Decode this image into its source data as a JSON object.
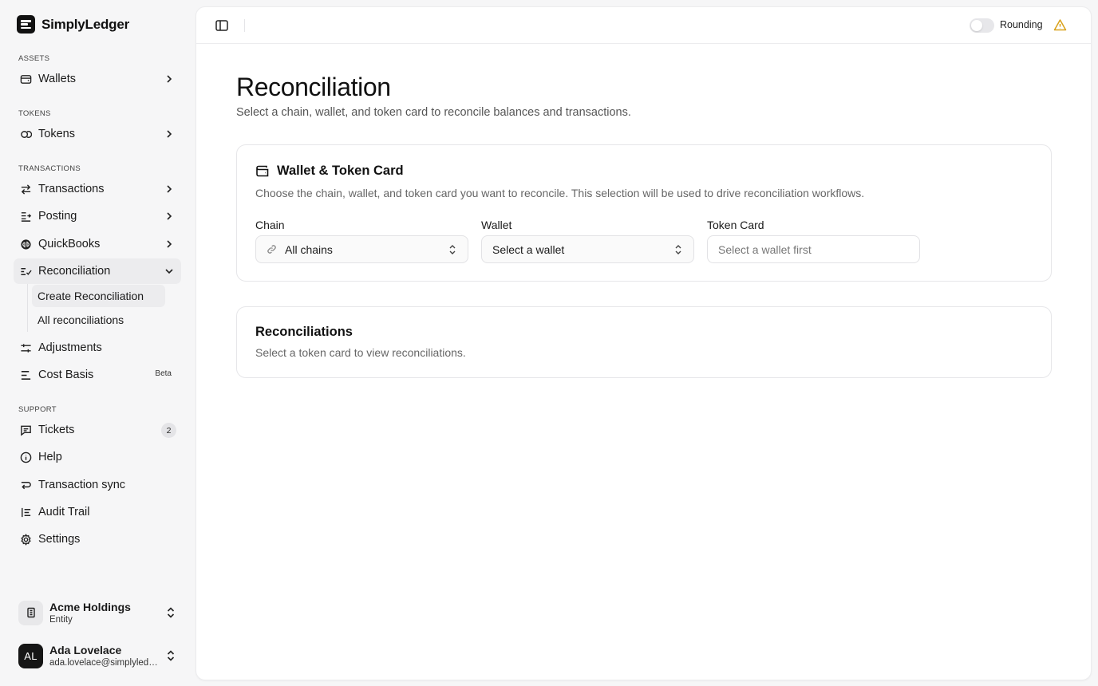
{
  "brand": {
    "name": "SimplyLedger"
  },
  "sidebar": {
    "sections": {
      "assets": "ASSETS",
      "tokens": "TOKENS",
      "transactions": "TRANSACTIONS",
      "support": "SUPPORT"
    },
    "items": {
      "wallets": "Wallets",
      "tokens": "Tokens",
      "transactions": "Transactions",
      "posting": "Posting",
      "quickbooks": "QuickBooks",
      "reconciliation": "Reconciliation",
      "create_reconciliation": "Create Reconciliation",
      "all_reconciliations": "All reconciliations",
      "adjustments": "Adjustments",
      "cost_basis": "Cost Basis",
      "cost_basis_badge": "Beta",
      "tickets": "Tickets",
      "tickets_count": "2",
      "help": "Help",
      "transaction_sync": "Transaction sync",
      "audit_trail": "Audit Trail",
      "settings": "Settings"
    },
    "entity": {
      "name": "Acme Holdings",
      "type": "Entity"
    },
    "user": {
      "initials": "AL",
      "name": "Ada Lovelace",
      "email": "ada.lovelace@simplyledger.io"
    }
  },
  "topbar": {
    "rounding_label": "Rounding",
    "rounding_on": false
  },
  "page": {
    "title": "Reconciliation",
    "subtitle": "Select a chain, wallet, and token card to reconcile balances and transactions."
  },
  "selection_card": {
    "title": "Wallet & Token Card",
    "description": "Choose the chain, wallet, and token card you want to reconcile. This selection will be used to drive reconciliation workflows.",
    "chain_label": "Chain",
    "chain_value": "All chains",
    "wallet_label": "Wallet",
    "wallet_value": "Select a wallet",
    "token_card_label": "Token Card",
    "token_card_placeholder": "Select a wallet first"
  },
  "reconciliations_card": {
    "title": "Reconciliations",
    "description": "Select a token card to view reconciliations."
  }
}
